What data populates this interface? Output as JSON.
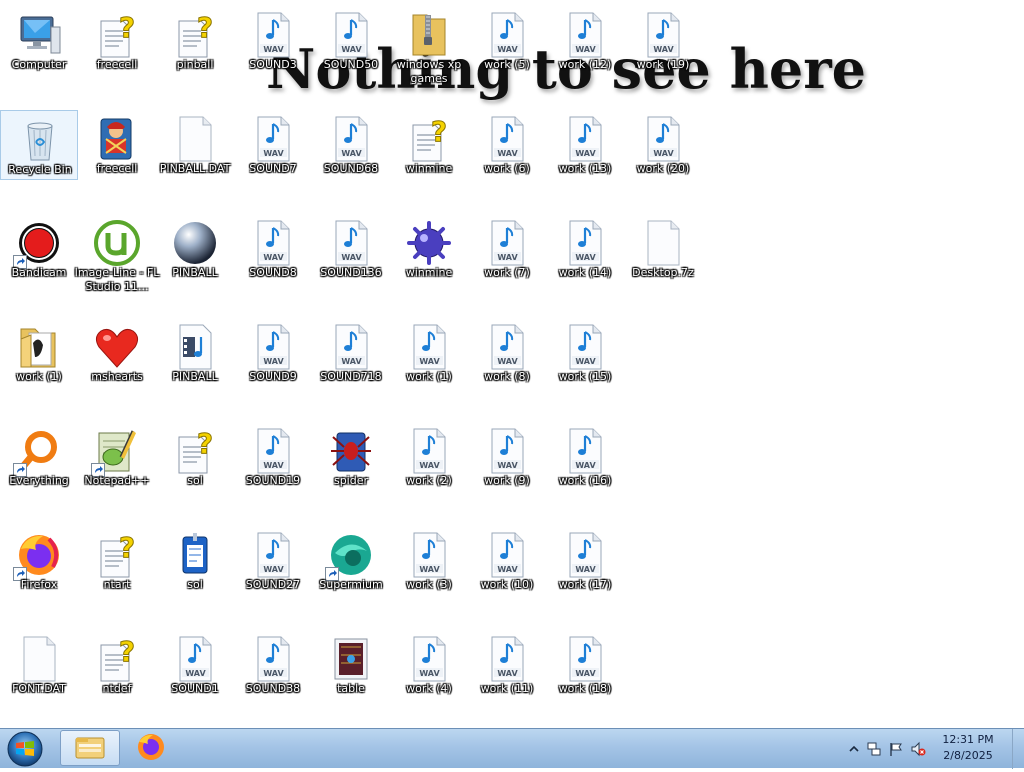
{
  "wallpaper": {
    "text": "Nothing to see here"
  },
  "icons": [
    {
      "id": "computer",
      "label": "Computer",
      "icon": "computer-icon",
      "col": 0,
      "row": 0
    },
    {
      "id": "recycle-bin",
      "label": "Recycle Bin",
      "icon": "recycle-bin-icon",
      "col": 0,
      "row": 1,
      "selected": true
    },
    {
      "id": "bandicam",
      "label": "Bandicam",
      "icon": "bandicam-icon",
      "col": 0,
      "row": 2,
      "shortcut": true
    },
    {
      "id": "work-1-folder",
      "label": "work (1)",
      "icon": "folder-icon",
      "col": 0,
      "row": 3
    },
    {
      "id": "everything",
      "label": "Everything",
      "icon": "everything-icon",
      "col": 0,
      "row": 4,
      "shortcut": true
    },
    {
      "id": "firefox",
      "label": "Firefox",
      "icon": "firefox-icon",
      "col": 0,
      "row": 5,
      "shortcut": true
    },
    {
      "id": "font-dat",
      "label": "FONT.DAT",
      "icon": "blank-file-icon",
      "col": 0,
      "row": 6
    },
    {
      "id": "freecell-help",
      "label": "freecell",
      "icon": "help-file-icon",
      "col": 1,
      "row": 0
    },
    {
      "id": "freecell",
      "label": "freecell",
      "icon": "freecell-icon",
      "col": 1,
      "row": 1
    },
    {
      "id": "fl-studio",
      "label": "Image-Line - FL Studio 11...",
      "icon": "utorrent-icon",
      "col": 1,
      "row": 2
    },
    {
      "id": "mshearts",
      "label": "mshearts",
      "icon": "heart-icon",
      "col": 1,
      "row": 3
    },
    {
      "id": "notepadpp",
      "label": "Notepad++",
      "icon": "notepadpp-icon",
      "col": 1,
      "row": 4,
      "shortcut": true
    },
    {
      "id": "ntart",
      "label": "ntart",
      "icon": "help-file-icon",
      "col": 1,
      "row": 5
    },
    {
      "id": "ntdef",
      "label": "ntdef",
      "icon": "help-file-icon",
      "col": 1,
      "row": 6
    },
    {
      "id": "pinball-help",
      "label": "pinball",
      "icon": "help-file-icon",
      "col": 2,
      "row": 0
    },
    {
      "id": "pinball-dat",
      "label": "PINBALL.DAT",
      "icon": "blank-file-icon",
      "col": 2,
      "row": 1
    },
    {
      "id": "pinball-exe",
      "label": "PINBALL",
      "icon": "pinball-icon",
      "col": 2,
      "row": 2
    },
    {
      "id": "pinball-mid",
      "label": "PINBALL",
      "icon": "media-file-icon",
      "col": 2,
      "row": 3
    },
    {
      "id": "sol-help",
      "label": "sol",
      "icon": "help-file-icon",
      "col": 2,
      "row": 4
    },
    {
      "id": "sol-exe",
      "label": "sol",
      "icon": "sol-icon",
      "col": 2,
      "row": 5
    },
    {
      "id": "sound1",
      "label": "SOUND1",
      "icon": "wav-file-icon",
      "col": 2,
      "row": 6
    },
    {
      "id": "sound3",
      "label": "SOUND3",
      "icon": "wav-file-icon",
      "col": 3,
      "row": 0
    },
    {
      "id": "sound7",
      "label": "SOUND7",
      "icon": "wav-file-icon",
      "col": 3,
      "row": 1
    },
    {
      "id": "sound8",
      "label": "SOUND8",
      "icon": "wav-file-icon",
      "col": 3,
      "row": 2
    },
    {
      "id": "sound9",
      "label": "SOUND9",
      "icon": "wav-file-icon",
      "col": 3,
      "row": 3
    },
    {
      "id": "sound19",
      "label": "SOUND19",
      "icon": "wav-file-icon",
      "col": 3,
      "row": 4
    },
    {
      "id": "sound27",
      "label": "SOUND27",
      "icon": "wav-file-icon",
      "col": 3,
      "row": 5
    },
    {
      "id": "sound38",
      "label": "SOUND38",
      "icon": "wav-file-icon",
      "col": 3,
      "row": 6
    },
    {
      "id": "sound50",
      "label": "SOUND50",
      "icon": "wav-file-icon",
      "col": 4,
      "row": 0
    },
    {
      "id": "sound68",
      "label": "SOUND68",
      "icon": "wav-file-icon",
      "col": 4,
      "row": 1
    },
    {
      "id": "sound136",
      "label": "SOUND136",
      "icon": "wav-file-icon",
      "col": 4,
      "row": 2
    },
    {
      "id": "sound718",
      "label": "SOUND718",
      "icon": "wav-file-icon",
      "col": 4,
      "row": 3
    },
    {
      "id": "spider",
      "label": "spider",
      "icon": "spider-icon",
      "col": 4,
      "row": 4
    },
    {
      "id": "supermium",
      "label": "Supermium",
      "icon": "supermium-icon",
      "col": 4,
      "row": 5,
      "shortcut": true
    },
    {
      "id": "table",
      "label": "table",
      "icon": "table-bitmap-icon",
      "col": 4,
      "row": 6
    },
    {
      "id": "winxp-games",
      "label": "windows xp games",
      "icon": "zip-folder-icon",
      "col": 5,
      "row": 0
    },
    {
      "id": "winmine-help",
      "label": "winmine",
      "icon": "help-file-icon",
      "col": 5,
      "row": 1
    },
    {
      "id": "winmine",
      "label": "winmine",
      "icon": "mine-icon",
      "col": 5,
      "row": 2
    },
    {
      "id": "work-1",
      "label": "work (1)",
      "icon": "wav-file-icon",
      "col": 5,
      "row": 3
    },
    {
      "id": "work-2",
      "label": "work (2)",
      "icon": "wav-file-icon",
      "col": 5,
      "row": 4
    },
    {
      "id": "work-3",
      "label": "work (3)",
      "icon": "wav-file-icon",
      "col": 5,
      "row": 5
    },
    {
      "id": "work-4",
      "label": "work (4)",
      "icon": "wav-file-icon",
      "col": 5,
      "row": 6
    },
    {
      "id": "work-5",
      "label": "work (5)",
      "icon": "wav-file-icon",
      "col": 6,
      "row": 0
    },
    {
      "id": "work-6",
      "label": "work (6)",
      "icon": "wav-file-icon",
      "col": 6,
      "row": 1
    },
    {
      "id": "work-7",
      "label": "work (7)",
      "icon": "wav-file-icon",
      "col": 6,
      "row": 2
    },
    {
      "id": "work-8",
      "label": "work (8)",
      "icon": "wav-file-icon",
      "col": 6,
      "row": 3
    },
    {
      "id": "work-9",
      "label": "work (9)",
      "icon": "wav-file-icon",
      "col": 6,
      "row": 4
    },
    {
      "id": "work-10",
      "label": "work (10)",
      "icon": "wav-file-icon",
      "col": 6,
      "row": 5
    },
    {
      "id": "work-11",
      "label": "work (11)",
      "icon": "wav-file-icon",
      "col": 6,
      "row": 6
    },
    {
      "id": "work-12",
      "label": "work (12)",
      "icon": "wav-file-icon",
      "col": 7,
      "row": 0
    },
    {
      "id": "work-13",
      "label": "work (13)",
      "icon": "wav-file-icon",
      "col": 7,
      "row": 1
    },
    {
      "id": "work-14",
      "label": "work (14)",
      "icon": "wav-file-icon",
      "col": 7,
      "row": 2
    },
    {
      "id": "work-15",
      "label": "work (15)",
      "icon": "wav-file-icon",
      "col": 7,
      "row": 3
    },
    {
      "id": "work-16",
      "label": "work (16)",
      "icon": "wav-file-icon",
      "col": 7,
      "row": 4
    },
    {
      "id": "work-17",
      "label": "work (17)",
      "icon": "wav-file-icon",
      "col": 7,
      "row": 5
    },
    {
      "id": "work-18",
      "label": "work (18)",
      "icon": "wav-file-icon",
      "col": 7,
      "row": 6
    },
    {
      "id": "work-19",
      "label": "work (19)",
      "icon": "wav-file-icon",
      "col": 8,
      "row": 0
    },
    {
      "id": "work-20",
      "label": "work (20)",
      "icon": "wav-file-icon",
      "col": 8,
      "row": 1
    },
    {
      "id": "desktop-7z",
      "label": "Desktop.7z",
      "icon": "blank-file-icon",
      "col": 8,
      "row": 2
    }
  ],
  "taskbar": {
    "start_icon": "windows-logo-icon",
    "pinned": [
      {
        "id": "explorer",
        "icon": "explorer-icon",
        "active": true
      },
      {
        "id": "firefox",
        "icon": "firefox-icon",
        "active": false
      }
    ],
    "tray": {
      "icons": [
        "show-hidden-icons-icon",
        "network-icon",
        "action-center-flag-icon",
        "volume-muted-icon"
      ],
      "time": "12:31 PM",
      "date": "2/8/2025"
    }
  }
}
